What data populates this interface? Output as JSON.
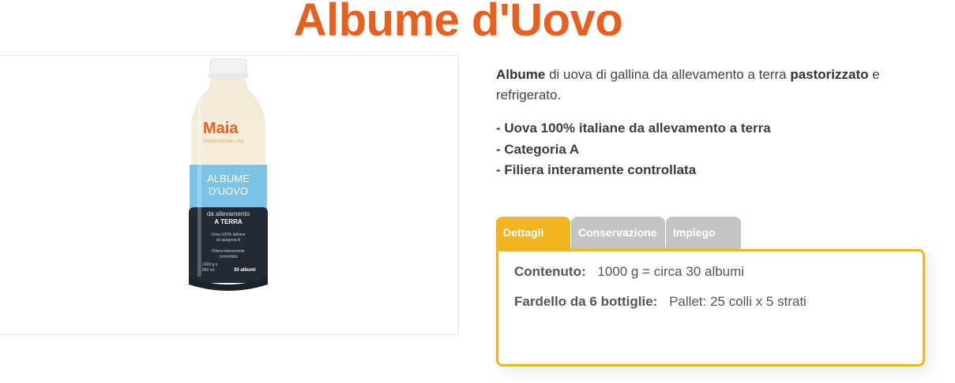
{
  "title": "Albume d'Uovo",
  "product_image": {
    "brand": "Maia",
    "brand_sub": "PROFESSIONAL LINE",
    "label_line1": "ALBUME",
    "label_line2": "D'UOVO",
    "label_line3": "da allevamento",
    "label_line4": "A TERRA",
    "label_small1": "Uova 100% italiane",
    "label_small2": "di categoria A",
    "label_small3": "Filiera interamente",
    "label_small4": "controllata",
    "label_qty1": "1000 g e",
    "label_qty2": "960 ml",
    "label_count": "30 albumi"
  },
  "description": {
    "bold1": "Albume",
    "text1": " di uova di gallina da allevamento a terra ",
    "bold2": "pastorizzato",
    "text2": " e refrigerato."
  },
  "features": [
    "- Uova 100% italiane da allevamento a terra",
    "- Categoria A",
    "- Filiera interamente controllata"
  ],
  "tabs": [
    {
      "label": "Dettagli",
      "active": true
    },
    {
      "label": "Conservazione",
      "active": false
    },
    {
      "label": "Impiego",
      "active": false
    }
  ],
  "details": [
    {
      "label": "Contenuto:",
      "value": "1000 g = circa 30 albumi"
    },
    {
      "label": "Fardello da 6 bottiglie:",
      "value": "Pallet: 25 colli x 5 strati"
    }
  ],
  "colors": {
    "title": "#e8601f",
    "tab_active": "#f0b51f",
    "tab_inactive": "#c4c4c4",
    "bottle_label_blue": "#7cc3e6",
    "bottle_label_dark": "#232a36"
  }
}
